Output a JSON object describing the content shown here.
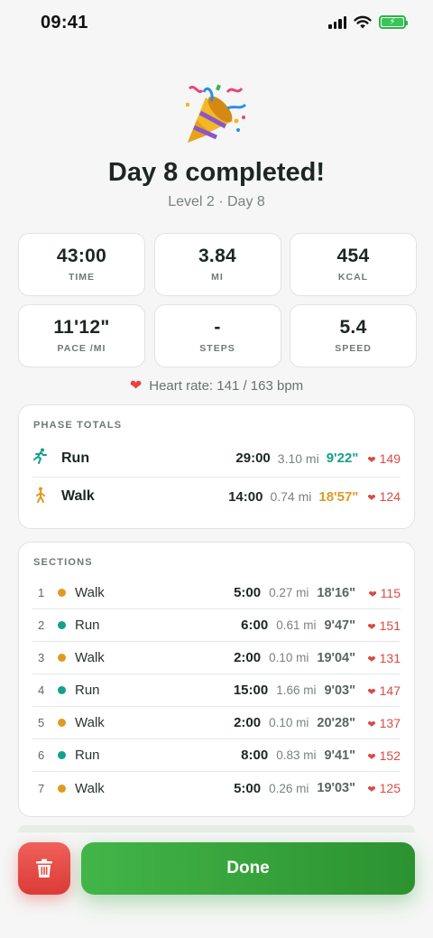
{
  "status_bar": {
    "time": "09:41",
    "icons": [
      "cellular-signal-icon",
      "wifi-icon",
      "battery-charging-icon"
    ]
  },
  "header": {
    "icon": "party-popper-icon",
    "title": "Day 8 completed!",
    "subtitle": "Level 2 · Day 8"
  },
  "stats": [
    {
      "value": "43:00",
      "label": "TIME"
    },
    {
      "value": "3.84",
      "label": "MI"
    },
    {
      "value": "454",
      "label": "KCAL"
    },
    {
      "value": "11'12\"",
      "label": "PACE /MI"
    },
    {
      "value": "-",
      "label": "STEPS"
    },
    {
      "value": "5.4",
      "label": "SPEED"
    }
  ],
  "heart_rate": {
    "text": "Heart rate: 141 / 163 bpm"
  },
  "phase_totals": {
    "heading": "PHASE TOTALS",
    "rows": [
      {
        "name": "Run",
        "time": "29:00",
        "distance": "3.10 mi",
        "pace": "9'22\"",
        "hr": "149"
      },
      {
        "name": "Walk",
        "time": "14:00",
        "distance": "0.74 mi",
        "pace": "18'57\"",
        "hr": "124"
      }
    ]
  },
  "sections": {
    "heading": "SECTIONS",
    "rows": [
      {
        "num": "1",
        "name": "Walk",
        "time": "5:00",
        "distance": "0.27 mi",
        "pace": "18'16\"",
        "hr": "115"
      },
      {
        "num": "2",
        "name": "Run",
        "time": "6:00",
        "distance": "0.61 mi",
        "pace": "9'47\"",
        "hr": "151"
      },
      {
        "num": "3",
        "name": "Walk",
        "time": "2:00",
        "distance": "0.10 mi",
        "pace": "19'04\"",
        "hr": "131"
      },
      {
        "num": "4",
        "name": "Run",
        "time": "15:00",
        "distance": "1.66 mi",
        "pace": "9'03\"",
        "hr": "147"
      },
      {
        "num": "5",
        "name": "Walk",
        "time": "2:00",
        "distance": "0.10 mi",
        "pace": "20'28\"",
        "hr": "137"
      },
      {
        "num": "6",
        "name": "Run",
        "time": "8:00",
        "distance": "0.83 mi",
        "pace": "9'41\"",
        "hr": "152"
      },
      {
        "num": "7",
        "name": "Walk",
        "time": "5:00",
        "distance": "0.26 mi",
        "pace": "19'03\"",
        "hr": "125"
      }
    ]
  },
  "buttons": {
    "delete_icon": "trash-icon",
    "done_label": "Done"
  },
  "colors": {
    "run": "#15a08a",
    "walk": "#df9a24",
    "heart": "#e8413e",
    "done": "#39a83e",
    "delete": "#e84a44"
  }
}
